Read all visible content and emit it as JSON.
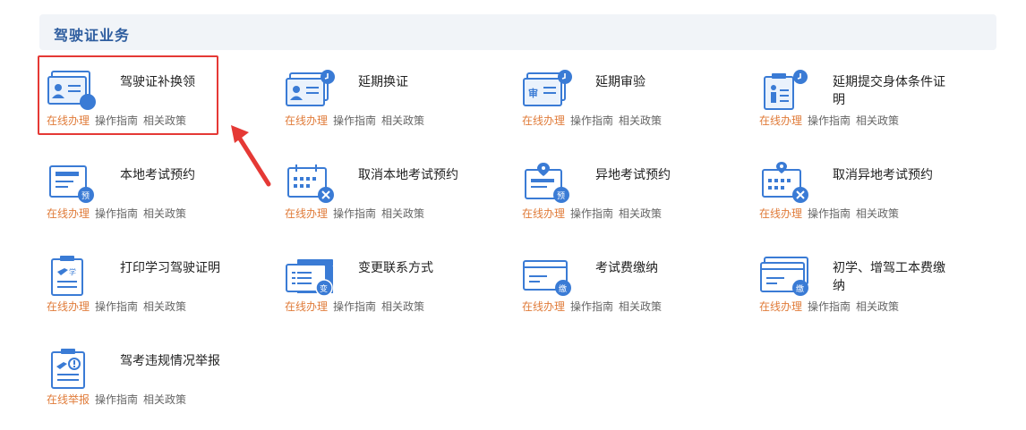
{
  "section": {
    "title": "驾驶证业务"
  },
  "colors": {
    "accent": "#3a7bd5",
    "link_primary": "#e07b39",
    "highlight": "#e53935",
    "header_bg": "#f1f4f8"
  },
  "cards": [
    {
      "title": "驾驶证补换领",
      "icon": "license-card-icon",
      "links": [
        "在线办理",
        "操作指南",
        "相关政策"
      ]
    },
    {
      "title": "延期换证",
      "icon": "license-clock-icon",
      "links": [
        "在线办理",
        "操作指南",
        "相关政策"
      ]
    },
    {
      "title": "延期审验",
      "icon": "review-card-clock-icon",
      "links": [
        "在线办理",
        "操作指南",
        "相关政策"
      ]
    },
    {
      "title": "延期提交身体条件证明",
      "icon": "person-clipboard-clock-icon",
      "links": [
        "在线办理",
        "操作指南",
        "相关政策"
      ]
    },
    {
      "title": "本地考试预约",
      "icon": "exam-booking-icon",
      "badge": "预",
      "links": [
        "在线办理",
        "操作指南",
        "相关政策"
      ]
    },
    {
      "title": "取消本地考试预约",
      "icon": "calendar-cancel-icon",
      "links": [
        "在线办理",
        "操作指南",
        "相关政策"
      ]
    },
    {
      "title": "异地考试预约",
      "icon": "location-booking-icon",
      "badge": "预",
      "links": [
        "在线办理",
        "操作指南",
        "相关政策"
      ]
    },
    {
      "title": "取消异地考试预约",
      "icon": "location-calendar-cancel-icon",
      "links": [
        "在线办理",
        "操作指南",
        "相关政策"
      ]
    },
    {
      "title": "打印学习驾驶证明",
      "icon": "learner-clipboard-icon",
      "badge": "学",
      "links": [
        "在线办理",
        "操作指南",
        "相关政策"
      ]
    },
    {
      "title": "变更联系方式",
      "icon": "contact-change-icon",
      "badge": "变",
      "links": [
        "在线办理",
        "操作指南",
        "相关政策"
      ]
    },
    {
      "title": "考试费缴纳",
      "icon": "exam-fee-icon",
      "badge": "缴",
      "links": [
        "在线办理",
        "操作指南",
        "相关政策"
      ]
    },
    {
      "title": "初学、增驾工本费缴纳",
      "icon": "cost-fee-icon",
      "badge": "缴",
      "links": [
        "在线办理",
        "操作指南",
        "相关政策"
      ]
    },
    {
      "title": "驾考违规情况举报",
      "icon": "violation-report-icon",
      "links": [
        "在线举报",
        "操作指南",
        "相关政策"
      ]
    }
  ]
}
